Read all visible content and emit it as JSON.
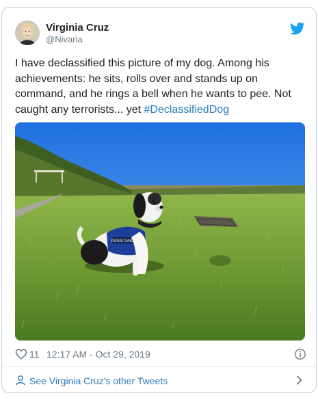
{
  "author": {
    "name": "Virginia Cruz",
    "handle": "@Nivaria"
  },
  "tweet": {
    "text": "I have declassified this picture of my dog. Among his achievements: he sits, rolls over and stands up on command, and he rings a bell when he wants to pee. Not caught any terrorists... yet ",
    "hashtag": "#DeclassifiedDog"
  },
  "photo": {
    "vest_text": "ASSISTANCE"
  },
  "meta": {
    "like_count": "11",
    "timestamp": "12:17 AM - Oct 29, 2019"
  },
  "footer": {
    "label": "See Virginia Cruz's other Tweets"
  },
  "colors": {
    "link": "#2b7bb9",
    "twitter_blue": "#1da1f2",
    "muted": "#697882",
    "border": "#c4cfd6"
  },
  "icons": [
    "twitter-bird-icon",
    "heart-icon",
    "info-icon",
    "person-icon",
    "chevron-right-icon"
  ]
}
